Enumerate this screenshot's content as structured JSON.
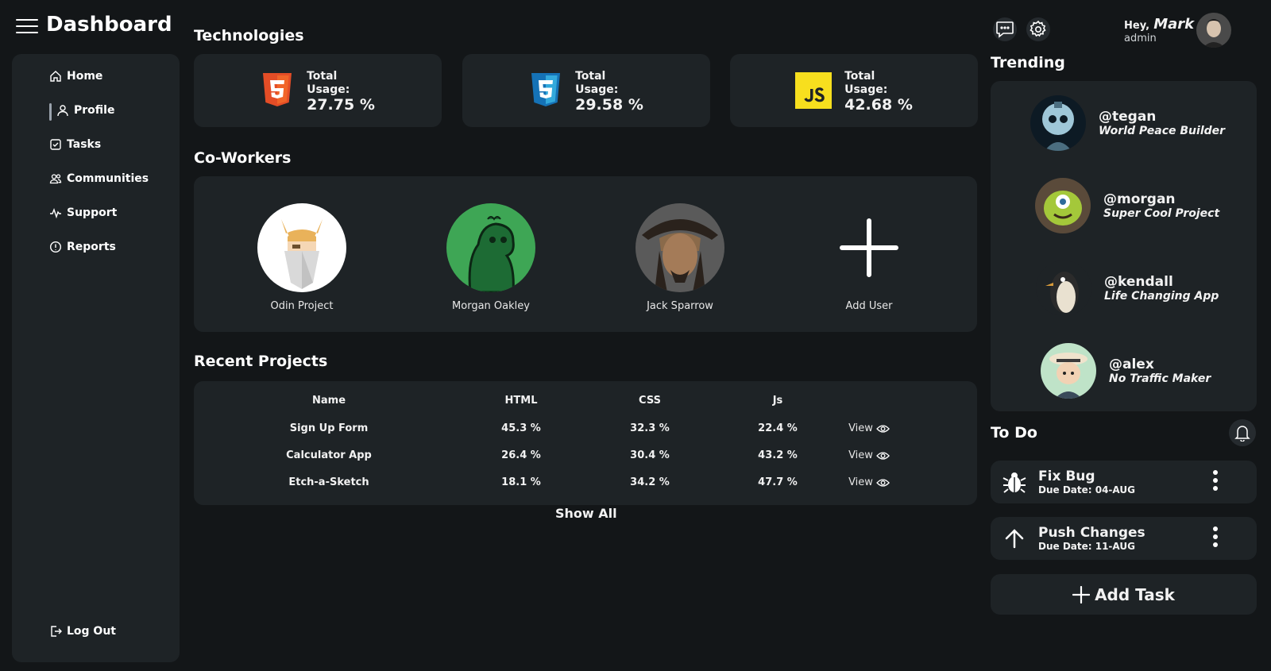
{
  "header": {
    "title": "Dashboard"
  },
  "sidebar": {
    "items": [
      {
        "label": "Home",
        "icon": "home-icon"
      },
      {
        "label": "Profile",
        "icon": "user-icon"
      },
      {
        "label": "Tasks",
        "icon": "checkbox-icon"
      },
      {
        "label": "Communities",
        "icon": "users-icon"
      },
      {
        "label": "Support",
        "icon": "pulse-icon"
      },
      {
        "label": "Reports",
        "icon": "alert-circle-icon"
      }
    ],
    "logout": "Log Out"
  },
  "technologies": {
    "title": "Technologies",
    "cards": [
      {
        "label": "Total Usage:",
        "value": "27.75 %",
        "icon": "html5-icon",
        "color": "#e44d26"
      },
      {
        "label": "Total Usage:",
        "value": "29.58 %",
        "icon": "css3-icon",
        "color": "#2f8bd7"
      },
      {
        "label": "Total Usage:",
        "value": "42.68 %",
        "icon": "javascript-icon",
        "color": "#f7df1e"
      }
    ]
  },
  "coworkers": {
    "title": "Co-Workers",
    "people": [
      {
        "name": "Odin Project"
      },
      {
        "name": "Morgan Oakley"
      },
      {
        "name": "Jack Sparrow"
      }
    ],
    "add_label": "Add User"
  },
  "projects": {
    "title": "Recent Projects",
    "columns": [
      "Name",
      "HTML",
      "CSS",
      "Js"
    ],
    "rows": [
      {
        "name": "Sign Up Form",
        "html": "45.3 %",
        "css": "32.3 %",
        "js": "22.4 %",
        "action": "View"
      },
      {
        "name": "Calculator App",
        "html": "26.4 %",
        "css": "30.4 %",
        "js": "43.2 %",
        "action": "View"
      },
      {
        "name": "Etch-a-Sketch",
        "html": "18.1 %",
        "css": "34.2 %",
        "js": "47.7 %",
        "action": "View"
      }
    ],
    "show_all": "Show All"
  },
  "user": {
    "greeting": "Hey,",
    "name": "Mark",
    "role": "admin"
  },
  "trending": {
    "title": "Trending",
    "items": [
      {
        "handle": "@tegan",
        "project": "World Peace Builder"
      },
      {
        "handle": "@morgan",
        "project": "Super Cool Project"
      },
      {
        "handle": "@kendall",
        "project": "Life Changing App"
      },
      {
        "handle": "@alex",
        "project": "No Traffic Maker"
      }
    ]
  },
  "todo": {
    "title": "To Do",
    "items": [
      {
        "title": "Fix Bug",
        "due": "Due Date: 04-AUG",
        "icon": "bug-icon"
      },
      {
        "title": "Push Changes",
        "due": "Due Date: 11-AUG",
        "icon": "arrow-up-icon"
      }
    ],
    "add_label": "Add Task"
  },
  "colors": {
    "background": "#131618",
    "panel": "#1e2326",
    "text": "#ffffff"
  }
}
